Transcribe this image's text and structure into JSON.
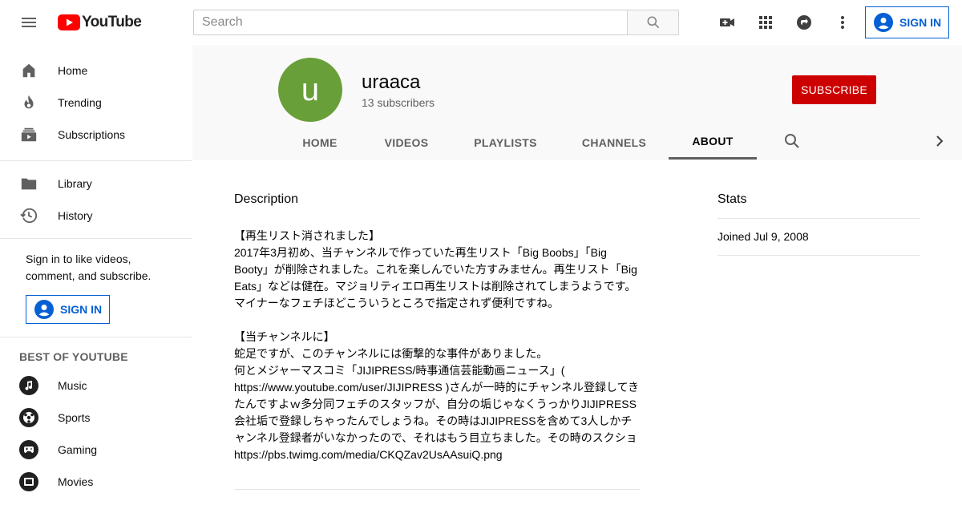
{
  "header": {
    "logo_text": "YouTube",
    "search_placeholder": "Search",
    "sign_in_label": "SIGN IN"
  },
  "sidebar": {
    "main": [
      {
        "label": "Home",
        "icon": "home-icon"
      },
      {
        "label": "Trending",
        "icon": "trending-icon"
      },
      {
        "label": "Subscriptions",
        "icon": "subscriptions-icon"
      }
    ],
    "library": [
      {
        "label": "Library",
        "icon": "library-icon"
      },
      {
        "label": "History",
        "icon": "history-icon"
      }
    ],
    "signin_prompt": "Sign in to like videos, comment, and subscribe.",
    "signin_label": "SIGN IN",
    "best_of_title": "BEST OF YOUTUBE",
    "best_of": [
      {
        "label": "Music",
        "icon": "music-icon"
      },
      {
        "label": "Sports",
        "icon": "sports-icon"
      },
      {
        "label": "Gaming",
        "icon": "gaming-icon"
      },
      {
        "label": "Movies",
        "icon": "movies-icon"
      }
    ]
  },
  "channel": {
    "avatar_letter": "u",
    "name": "uraaca",
    "subscribers": "13 subscribers",
    "subscribe_label": "SUBSCRIBE",
    "tabs": [
      "HOME",
      "VIDEOS",
      "PLAYLISTS",
      "CHANNELS",
      "ABOUT"
    ],
    "active_tab": "ABOUT"
  },
  "about": {
    "description_title": "Description",
    "description": "【再生リスト消されました】\n2017年3月初め、当チャンネルで作っていた再生リスト「Big Boobs」「Big Booty」が削除されました。これを楽しんでいた方すみません。再生リスト「Big Eats」などは健在。マジョリティエロ再生リストは削除されてしまうようです。マイナーなフェチほどこういうところで指定されず便利ですね。\n\n【当チャンネルに】\n蛇足ですが、このチャンネルには衝撃的な事件がありました。\n何とメジャーマスコミ「JIJIPRESS/時事通信芸能動画ニュース」( https://www.youtube.com/user/JIJIPRESS )さんが一時的にチャンネル登録してきたんですよｗ多分同フェチのスタッフが、自分の垢じゃなくうっかりJIJIPRESS会社垢で登録しちゃったんでしょうね。その時はJIJIPRESSを含めて3人しかチャンネル登録者がいなかったので、それはもう目立ちました。その時のスクショ https://pbs.twimg.com/media/CKQZav2UsAAsuiQ.png",
    "stats_title": "Stats",
    "joined": "Joined Jul 9, 2008"
  },
  "colors": {
    "brand_red": "#ff0000",
    "subscribe_red": "#cc0000",
    "link_blue": "#065fd4",
    "avatar_green": "#689f38"
  }
}
